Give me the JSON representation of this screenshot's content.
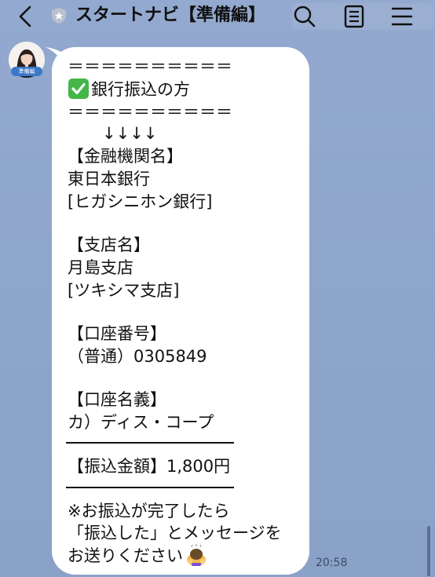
{
  "header": {
    "title": "スタートナビ【準備編】",
    "back_icon": "chevron-left-icon",
    "badge_icon": "official-shield-icon",
    "search_icon": "search-icon",
    "notes_icon": "notes-icon",
    "menu_icon": "hamburger-menu-icon"
  },
  "sender": {
    "avatar_label": "準備編"
  },
  "message": {
    "divider_top": "＝＝＝＝＝＝＝＝＝＝",
    "heading": "銀行振込の方",
    "divider_bottom": "＝＝＝＝＝＝＝＝＝＝",
    "arrows": "↓↓↓↓",
    "bank_label": "【金融機関名】",
    "bank_name": "東日本銀行",
    "bank_kana": "[ヒガシニホン銀行]",
    "branch_label": "【支店名】",
    "branch_name": "月島支店",
    "branch_kana": "[ツキシマ支店]",
    "account_label": "【口座番号】",
    "account_number": "（普通）0305849",
    "holder_label": "【口座名義】",
    "holder_name": "カ）ディス・コープ",
    "amount_line": "【振込金額】1,800円",
    "note_line1": "※お振込が完了したら",
    "note_line2": "「振込した」とメッセージを",
    "note_line3": "お送りください"
  },
  "timestamp": "20:58",
  "colors": {
    "background": "#8aa2c8",
    "bubble": "#ffffff",
    "check_green": "#43b649"
  }
}
